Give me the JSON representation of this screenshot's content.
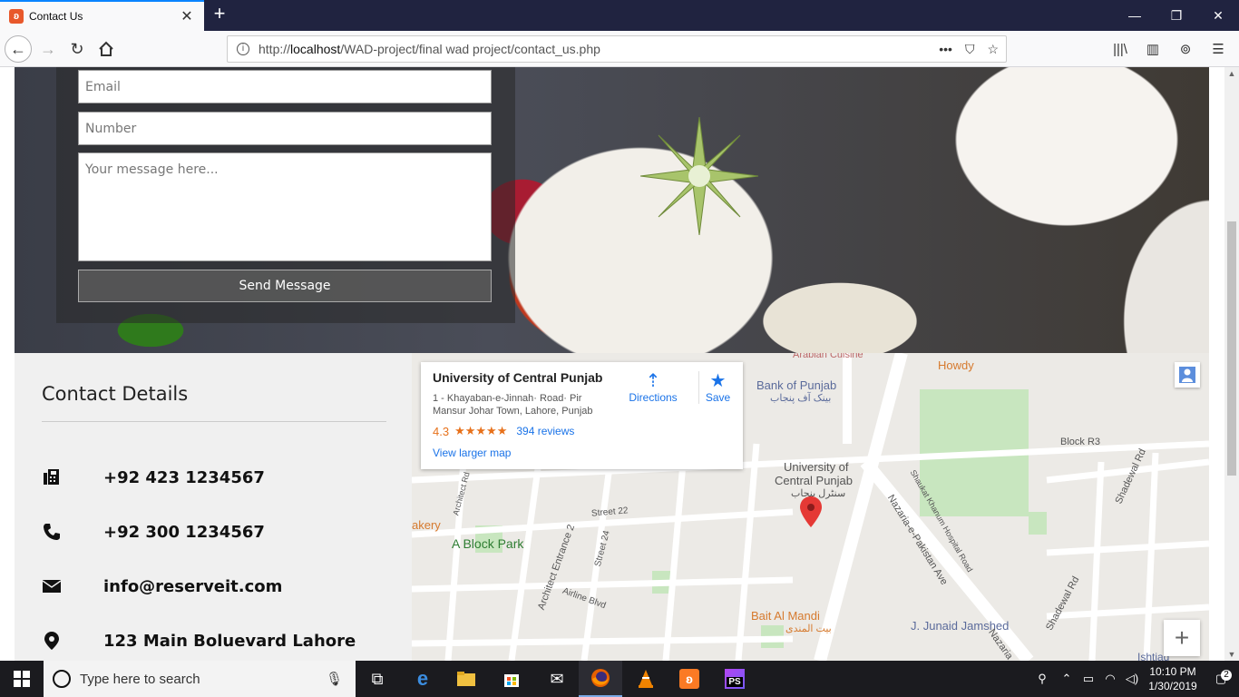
{
  "browser": {
    "tab_title": "Contact Us",
    "tab_favicon": "xampp-icon",
    "url_prefix": "http://",
    "url_host": "localhost",
    "url_path": "/WAD-project/final wad project/contact_us.php"
  },
  "form": {
    "email_placeholder": "Email",
    "number_placeholder": "Number",
    "message_placeholder": "Your message here...",
    "send_label": "Send Message"
  },
  "contact": {
    "title": "Contact Details",
    "items": [
      {
        "icon": "fax-icon",
        "text": "+92 423 1234567"
      },
      {
        "icon": "phone-icon",
        "text": "+92 300 1234567"
      },
      {
        "icon": "envelope-icon",
        "text": "info@reserveit.com"
      },
      {
        "icon": "map-marker-icon",
        "text": "123 Main Boluevard Lahore"
      }
    ]
  },
  "map": {
    "card_title": "University of Central Punjab",
    "card_address": "1 - Khayaban-e-Jinnah· Road· Pir Mansur Johar Town, Lahore, Punjab",
    "rating": "4.3",
    "stars": "★★★★★",
    "reviews": "394 reviews",
    "larger_map": "View larger map",
    "directions": "Directions",
    "save": "Save",
    "labels": {
      "bank": "Bank of Punjab",
      "bank_urdu": "بینک آف پنجاب",
      "howdy": "Howdy",
      "ucp_1": "University of",
      "ucp_2": "Central Punjab",
      "ucp_urdu": "سنٹرل پنجاب",
      "block_r3": "Block R3",
      "a_block_park": "A Block Park",
      "bakery": "akery",
      "bait": "Bait Al Mandi",
      "bait_urdu": "بیت المندی",
      "junaid": "J. Junaid Jamshed",
      "arabian": "Arabian Cuisine",
      "street22": "Street 22",
      "street24": "Street 24",
      "airline": "Airline Blvd",
      "architect2": "Architect Entrance 2",
      "architect_rd": "Architect Rd",
      "nazaria": "Nazaria-e-Pakistan Ave",
      "shaukat": "Shaukat Khanum Hospital Road",
      "shadewal": "Shadewal Rd",
      "shadewal2": "Shadewal Rd",
      "nazaria2": "Nazaria",
      "ishtiaq": "Ishtiaq"
    }
  },
  "taskbar": {
    "search_placeholder": "Type here to search",
    "time": "10:10 PM",
    "date": "1/30/2019",
    "notifications": "2"
  }
}
